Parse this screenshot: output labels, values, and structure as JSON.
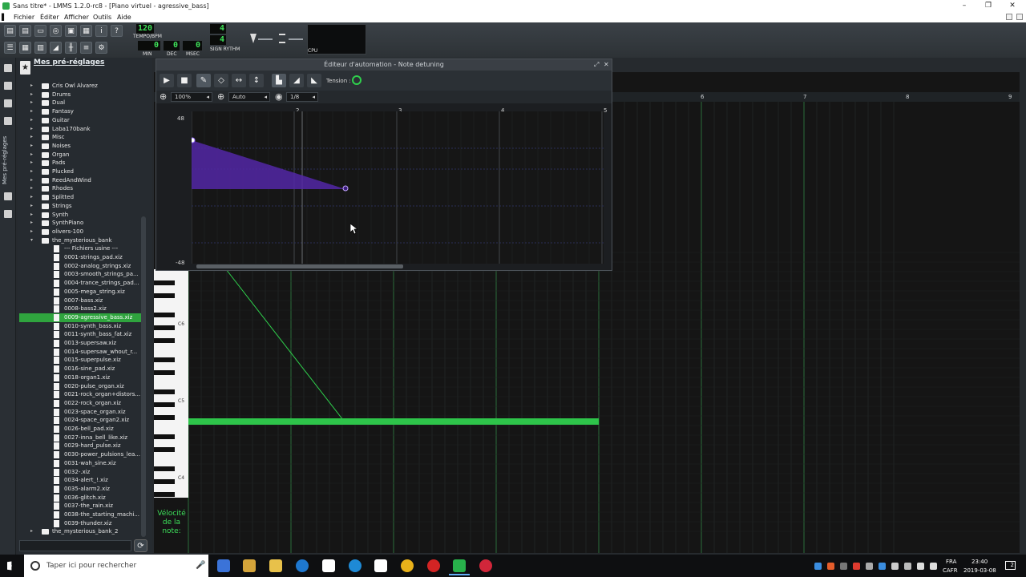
{
  "window": {
    "title": "Sans titre* - LMMS 1.2.0-rc8 - [Piano virtuel - agressive_bass]"
  },
  "menu": [
    "Fichier",
    "Éditer",
    "Afficher",
    "Outils",
    "Aide"
  ],
  "toolbar": {
    "tempo_value": "120",
    "tempo_label": "TEMPO/BPM",
    "time_min": "0",
    "time_dec": "0",
    "time_msec": "0",
    "min_label": "MIN",
    "dec_label": "DEC",
    "msec_label": "MSEC",
    "timesig_num": "4",
    "timesig_den": "4",
    "timesig_label": "SIGN RYTHM",
    "cpu_label": "CPU"
  },
  "sidebar": {
    "vertical_label": "Mes pré-réglages"
  },
  "browser": {
    "title": "Mes pré-réglages",
    "folders_top": [
      "Cris Owl Alvarez",
      "Drums",
      "Dual",
      "Fantasy",
      "Guitar",
      "Laba170bank",
      "Misc",
      "Noises",
      "Organ",
      "Pads",
      "Plucked",
      "ReedAndWind",
      "Rhodes",
      "Splitted",
      "Strings",
      "Synth",
      "SynthPiano",
      "olivers-100"
    ],
    "open_folder": "the_mysterious_bank",
    "files": [
      "--- Fichiers usine ---",
      "0001-strings_pad.xiz",
      "0002-analog_strings.xiz",
      "0003-smooth_strings_pa...",
      "0004-trance_strings_pad...",
      "0005-mega_string.xiz",
      "0007-bass.xiz",
      "0008-bass2.xiz",
      "0009-agressive_bass.xiz",
      "0010-synth_bass.xiz",
      "0011-synth_bass_fat.xiz",
      "0013-supersaw.xiz",
      "0014-supersaw_whout_r...",
      "0015-superpulse.xiz",
      "0016-sine_pad.xiz",
      "0018-organ1.xiz",
      "0020-pulse_organ.xiz",
      "0021-rock_organ+distors...",
      "0022-rock_organ.xiz",
      "0023-space_organ.xiz",
      "0024-space_organ2.xiz",
      "0026-bell_pad.xiz",
      "0027-inna_bell_like.xiz",
      "0029-hard_pulse.xiz",
      "0030-power_pulsions_lea...",
      "0031-wah_sine.xiz",
      "0032-.xiz",
      "0034-alert_!.xiz",
      "0035-alarm2.xiz",
      "0036-glitch.xiz",
      "0037-the_rain.xiz",
      "0038-the_starting_machi...",
      "0039-thunder.xiz"
    ],
    "selected": "0009-agressive_bass.xiz",
    "folders_bottom": [
      "the_mysterious_bank_2"
    ]
  },
  "automation": {
    "title": "Éditeur d'automation - Note detuning",
    "tension_label": "Tension :",
    "zoom_x": "100%",
    "quantize_mode": "Auto",
    "quantize": "1/8",
    "y_max": "48",
    "y_min": "-48",
    "bar_numbers": [
      "2",
      "3",
      "4",
      "5"
    ]
  },
  "piano_roll": {
    "bar_numbers": [
      "6",
      "7",
      "8",
      "9"
    ],
    "key_labels": [
      "C6",
      "C5",
      "C4"
    ],
    "velocity_label": "Vélocité de la note:"
  },
  "taskbar": {
    "search_placeholder": "Taper ici pour rechercher",
    "lang": "FRA",
    "layout": "CAFR",
    "time": "23:40",
    "date": "2019-03-08",
    "notifications": "2"
  }
}
